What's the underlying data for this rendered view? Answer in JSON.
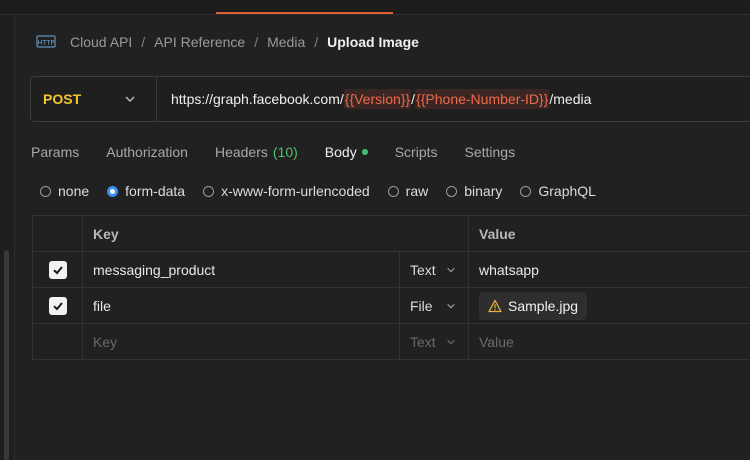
{
  "breadcrumb": {
    "items": [
      "Cloud API",
      "API Reference",
      "Media"
    ],
    "current": "Upload Image"
  },
  "request": {
    "method": "POST",
    "url_prefix": "https://graph.facebook.com/",
    "var_version": "{{Version}}",
    "url_sep": "/",
    "var_phone": "{{Phone-Number-ID}}",
    "url_suffix": "/media"
  },
  "tabs": {
    "params": "Params",
    "authorization": "Authorization",
    "headers": "Headers",
    "headers_count": "(10)",
    "body": "Body",
    "scripts": "Scripts",
    "settings": "Settings"
  },
  "body_types": {
    "none": "none",
    "form_data": "form-data",
    "urlencoded": "x-www-form-urlencoded",
    "raw": "raw",
    "binary": "binary",
    "graphql": "GraphQL",
    "selected": "form-data"
  },
  "table": {
    "key_header": "Key",
    "value_header": "Value",
    "rows": [
      {
        "key": "messaging_product",
        "type": "Text",
        "value": "whatsapp",
        "checked": true
      },
      {
        "key": "file",
        "type": "File",
        "value": "Sample.jpg",
        "checked": true
      }
    ],
    "placeholder_key": "Key",
    "placeholder_type": "Text",
    "placeholder_value": "Value"
  },
  "colors": {
    "method": "#f4c430",
    "variable": "#ef6a4b",
    "accent": "#e0603a",
    "radio_selected": "#3a8ff5",
    "body_dot": "#3ec46d"
  }
}
